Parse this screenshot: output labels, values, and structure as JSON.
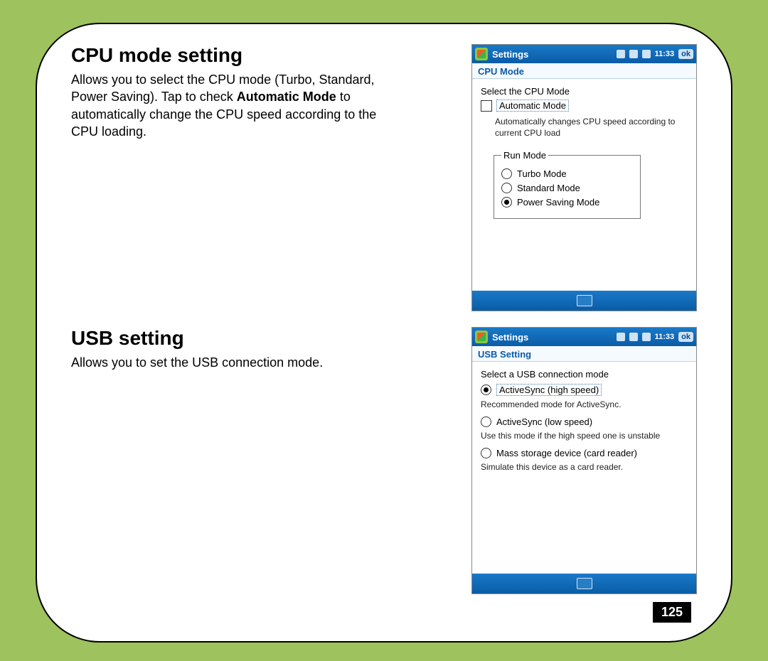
{
  "page_number": "125",
  "sections": {
    "cpu": {
      "title": "CPU mode setting",
      "body_pre": "Allows you to select the CPU mode (Turbo, Standard, Power Saving). Tap to check ",
      "body_bold": "Automatic Mode",
      "body_post": " to automatically change the CPU speed according to the CPU loading."
    },
    "usb": {
      "title": "USB setting",
      "body": "Allows you to set the USB connection mode."
    }
  },
  "shots": {
    "cpu": {
      "title": "Settings",
      "time": "11:33",
      "ok": "ok",
      "subtitle": "CPU Mode",
      "prompt": "Select the CPU Mode",
      "checkbox_label": "Automatic Mode",
      "auto_desc": "Automatically changes CPU speed according to current CPU load",
      "legend": "Run Mode",
      "options": {
        "turbo": "Turbo Mode",
        "standard": "Standard Mode",
        "power": "Power Saving Mode"
      },
      "selected": "power"
    },
    "usb": {
      "title": "Settings",
      "time": "11:33",
      "ok": "ok",
      "subtitle": "USB Setting",
      "prompt": "Select a USB connection mode",
      "options": {
        "hs": {
          "label": "ActiveSync (high speed)",
          "desc": "Recommended mode for ActiveSync."
        },
        "ls": {
          "label": "ActiveSync (low speed)",
          "desc": "Use this mode if the high speed one is unstable"
        },
        "ms": {
          "label": "Mass storage device (card reader)",
          "desc": "Simulate this device as a card reader."
        }
      },
      "selected": "hs"
    }
  }
}
